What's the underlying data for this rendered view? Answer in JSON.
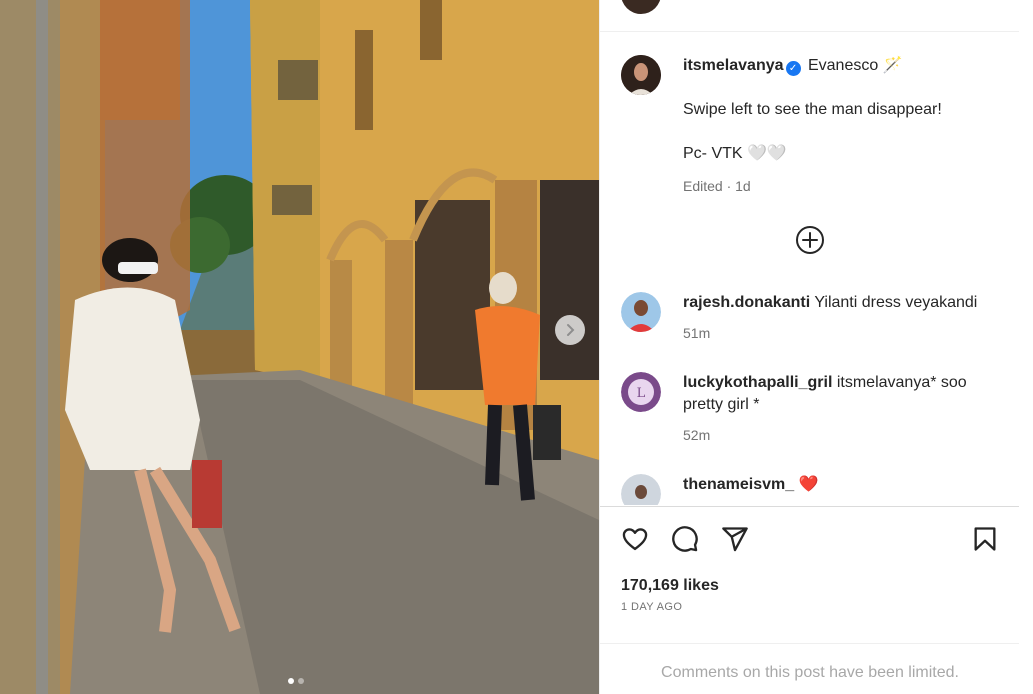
{
  "post": {
    "author": "itsmelavanya",
    "verified_mark": "✓",
    "caption_title": "Evanesco 🪄",
    "caption_line1": "Swipe left to see the man disappear!",
    "caption_line2": "Pc- VTK 🤍🤍",
    "caption_meta": "Edited · 1d",
    "likes": "170,169 likes",
    "time_ago": "1 DAY AGO",
    "comments_limited": "Comments on this post have been limited.",
    "carousel": {
      "current": 1,
      "total": 2
    }
  },
  "comments": [
    {
      "user": "rajesh.donakanti",
      "text": "Yilanti dress veyakandi",
      "time": "51m"
    },
    {
      "user": "luckykothapalli_gril",
      "text": "itsmelavanya* soo",
      "text2": "pretty girl *",
      "time": "52m"
    },
    {
      "user": "thenameisvm_",
      "text": "❤️"
    }
  ],
  "icons": {
    "like": "heart-icon",
    "comment": "comment-icon",
    "share": "send-icon",
    "save": "bookmark-icon",
    "more_comments": "plus-circle-icon",
    "next": "chevron-right-icon",
    "verified": "verified-badge-icon"
  },
  "colors": {
    "verified": "#1877f2",
    "heart": "#ed4956",
    "muted": "#737373",
    "limited": "#a8a8a8"
  }
}
